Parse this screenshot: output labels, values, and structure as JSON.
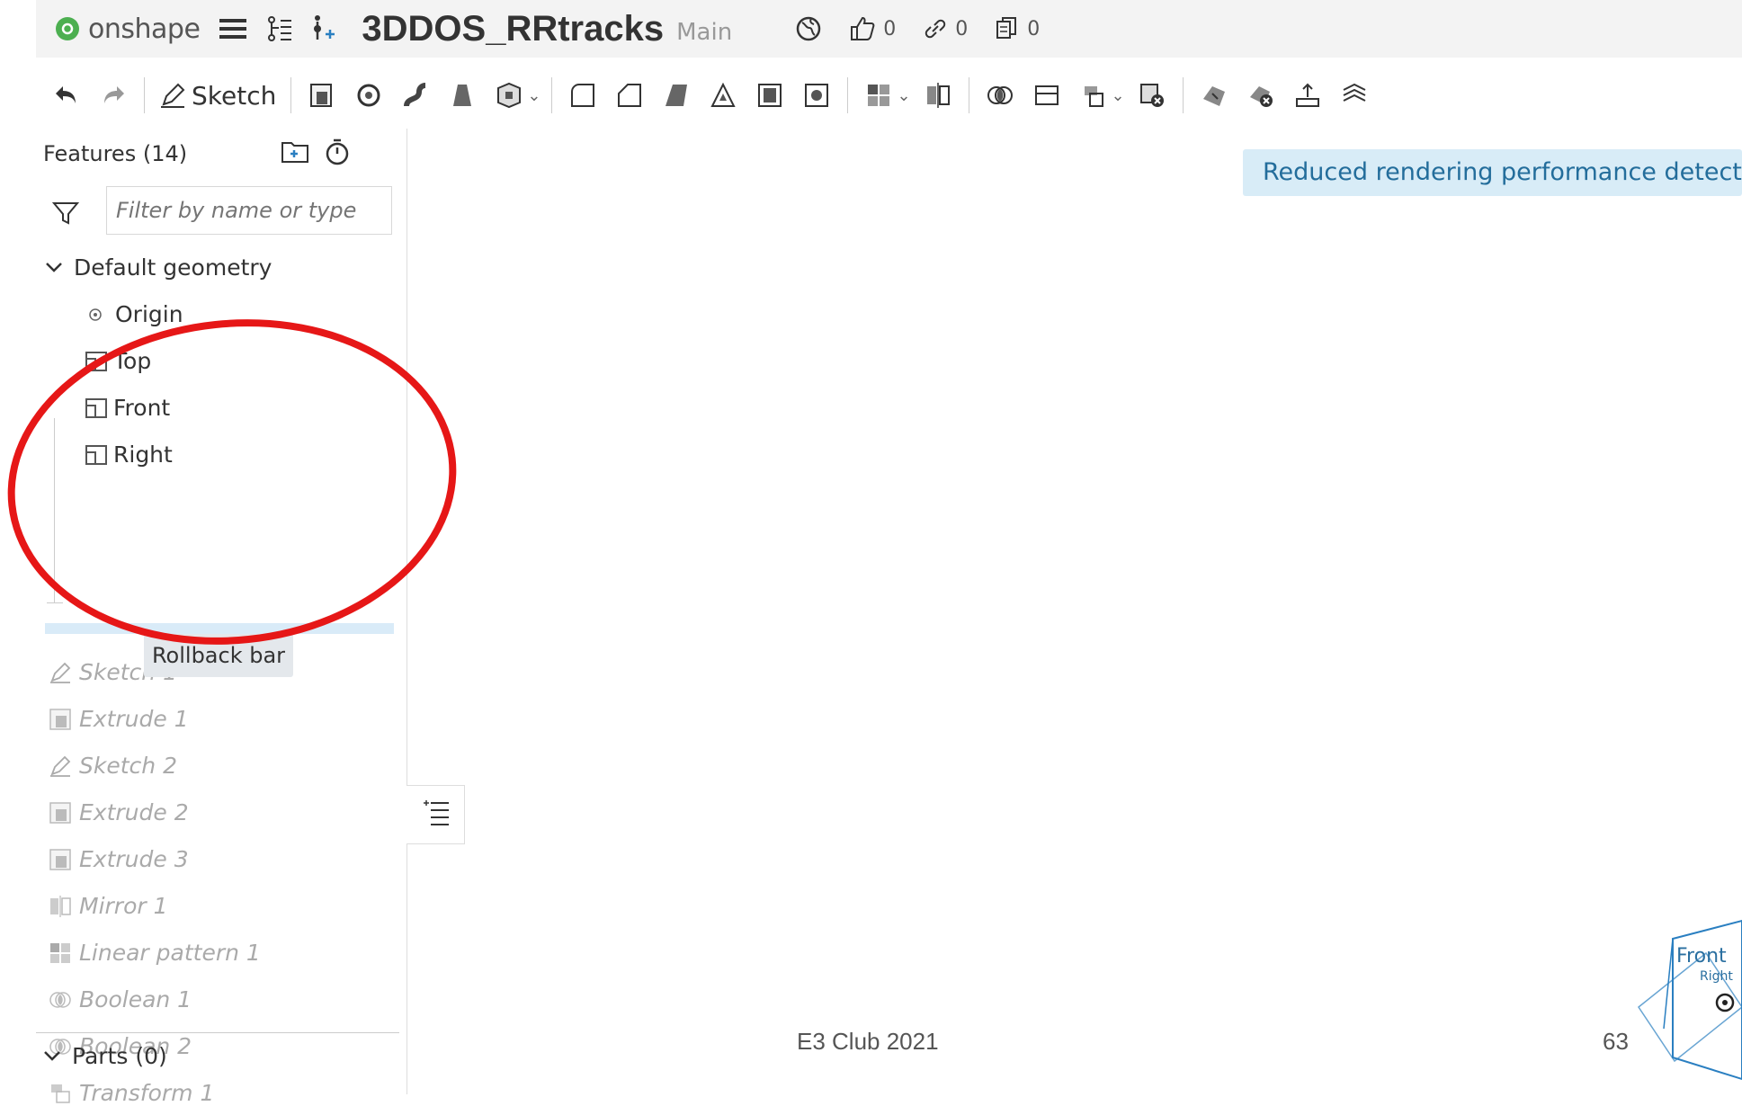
{
  "app": {
    "brand": "onshape",
    "document_title": "3DDOS_RRtracks",
    "branch": "Main",
    "likes_count": "0",
    "links_count": "0",
    "copies_count": "0"
  },
  "toolbar": {
    "sketch_label": "Sketch",
    "tools": [
      "extrude-icon",
      "revolve-icon",
      "sweep-icon",
      "loft-icon",
      "thicken-icon",
      "fillet-icon",
      "chamfer-icon",
      "draft-icon",
      "shell-icon",
      "hole-icon",
      "rib-icon",
      "pattern-icon",
      "mirror-icon",
      "boolean-icon",
      "split-icon",
      "transform-icon",
      "delete-part-icon",
      "modify-fillet-icon",
      "delete-face-icon",
      "move-face-icon",
      "offset-surface-icon"
    ]
  },
  "feature_panel": {
    "header": "Features (14)",
    "filter_placeholder": "Filter by name or type",
    "default_geometry_label": "Default geometry",
    "default_items": [
      {
        "label": "Origin",
        "icon": "origin-icon"
      },
      {
        "label": "Top",
        "icon": "plane-icon"
      },
      {
        "label": "Front",
        "icon": "plane-icon"
      },
      {
        "label": "Right",
        "icon": "plane-icon"
      }
    ],
    "rollback_tooltip": "Rollback bar",
    "features": [
      {
        "label": "Sketch 1",
        "icon": "sketch-icon"
      },
      {
        "label": "Extrude 1",
        "icon": "extrude-icon"
      },
      {
        "label": "Sketch 2",
        "icon": "sketch-icon"
      },
      {
        "label": "Extrude 2",
        "icon": "extrude-icon"
      },
      {
        "label": "Extrude 3",
        "icon": "extrude-icon"
      },
      {
        "label": "Mirror 1",
        "icon": "mirror-icon"
      },
      {
        "label": "Linear pattern 1",
        "icon": "pattern-icon"
      },
      {
        "label": "Boolean 1",
        "icon": "boolean-icon"
      },
      {
        "label": "Boolean 2",
        "icon": "boolean-icon"
      },
      {
        "label": "Transform 1",
        "icon": "transform-icon"
      }
    ],
    "parts_label": "Parts (0)"
  },
  "viewport": {
    "notice": "Reduced rendering performance detected.",
    "viewcube_labels": [
      "Front",
      "Right"
    ]
  },
  "slide_footer": {
    "center_text": "E3 Club 2021",
    "page_number": "63"
  },
  "colors": {
    "accent_red": "#e61717",
    "notice_bg": "#d8ecf7",
    "notice_text": "#236d9b",
    "rollback_bar": "#d9ebf8",
    "brand_green": "#4caf50"
  }
}
